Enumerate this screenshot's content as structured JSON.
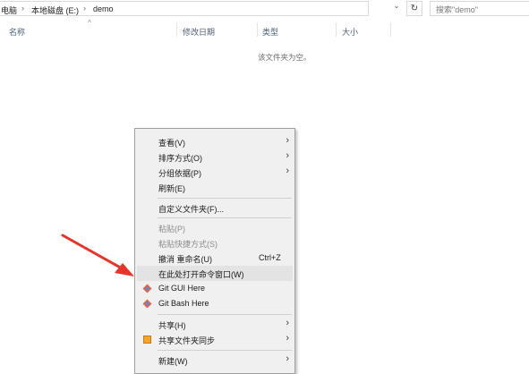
{
  "address": {
    "crumbs": [
      "电脑",
      "本地磁盘 (E:)",
      "demo"
    ],
    "dropdown_icon": "chevron-down-icon",
    "refresh_icon": "refresh-icon"
  },
  "search": {
    "placeholder": "搜索\"demo\""
  },
  "columns": {
    "name": "名称",
    "date": "修改日期",
    "type": "类型",
    "size": "大小"
  },
  "empty_message": "该文件夹为空。",
  "menu": {
    "view": "查看(V)",
    "sort": "排序方式(O)",
    "group": "分组依据(P)",
    "refresh": "刷新(E)",
    "customize": "自定义文件夹(F)...",
    "paste": "粘贴(P)",
    "paste_shortcut": "粘贴快捷方式(S)",
    "undo_rename": "撤消 重命名(U)",
    "undo_shortcut": "Ctrl+Z",
    "open_cmd": "在此处打开命令窗口(W)",
    "git_gui": "Git GUI Here",
    "git_bash": "Git Bash Here",
    "share": "共享(H)",
    "sync_share": "共享文件夹同步",
    "new": "新建(W)"
  },
  "colors": {
    "arrow": "#e8322a",
    "git_icon_primary": "#e8603c",
    "git_icon_secondary": "#4d8fe8"
  }
}
